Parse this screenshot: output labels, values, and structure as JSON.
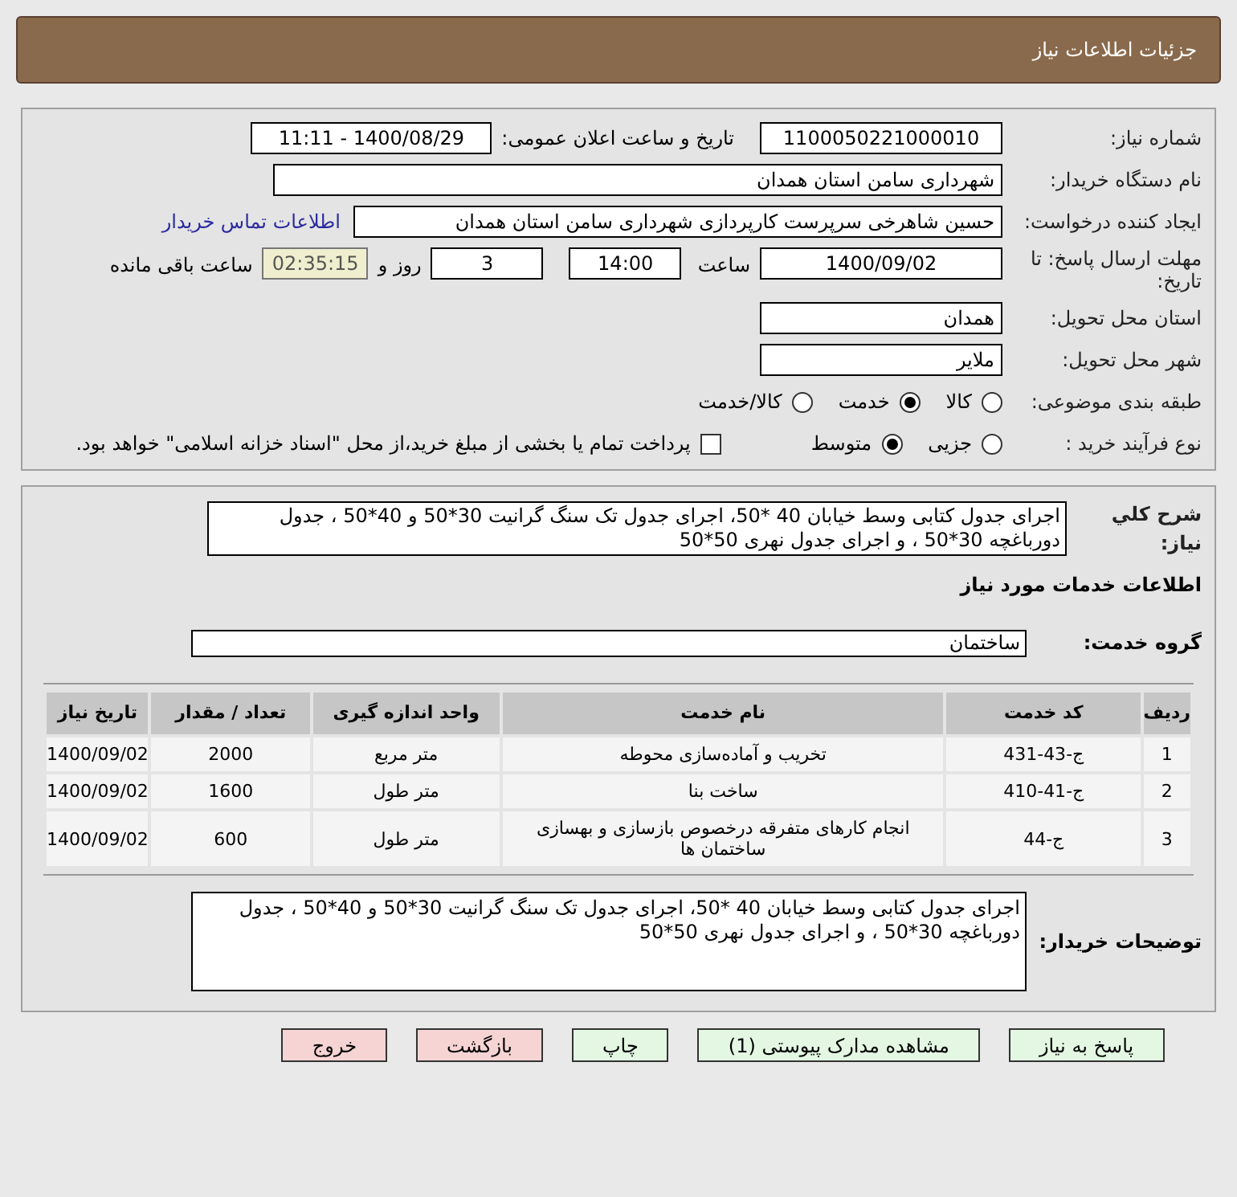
{
  "header": {
    "title": "جزئیات اطلاعات نیاز"
  },
  "need_number": {
    "label": "شماره نیاز:",
    "value": "1100050221000010"
  },
  "announce": {
    "label": "تاریخ و ساعت اعلان عمومی:",
    "value": "1400/08/29 - 11:11"
  },
  "buyer_org": {
    "label": "نام دستگاه خریدار:",
    "value": "شهرداری سامن استان همدان"
  },
  "requester": {
    "label": "ایجاد کننده درخواست:",
    "value": "حسین شاهرخی سرپرست کارپردازی شهرداری سامن استان همدان",
    "link": "اطلاعات تماس خریدار"
  },
  "deadline": {
    "label": "مهلت ارسال پاسخ: تا تاریخ:",
    "date": "1400/09/02",
    "time_label": "ساعت",
    "time": "14:00",
    "days": "3",
    "days_label": "روز و",
    "remaining": "02:35:15",
    "remaining_label": "ساعت باقی مانده"
  },
  "province": {
    "label": "استان محل تحویل:",
    "value": "همدان"
  },
  "city": {
    "label": "شهر محل تحویل:",
    "value": "ملایر"
  },
  "category": {
    "label": "طبقه بندی موضوعی:",
    "options": [
      {
        "label": "کالا",
        "selected": false
      },
      {
        "label": "خدمت",
        "selected": true
      },
      {
        "label": "کالا/خدمت",
        "selected": false
      }
    ]
  },
  "purchase_type": {
    "label": "نوع فرآیند خرید :",
    "options": [
      {
        "label": "جزیی",
        "selected": false
      },
      {
        "label": "متوسط",
        "selected": true
      }
    ],
    "payment_checkbox": {
      "checked": false,
      "label": "پرداخت تمام یا بخشی از مبلغ خرید،از محل \"اسناد خزانه اسلامی\" خواهد بود."
    }
  },
  "description": {
    "label": "شرح کلي نیاز:",
    "value": "اجرای جدول کتابی وسط خیابان  40 *50، اجرای جدول تک سنگ گرانیت 30*50  و 40*50 ، جدول دورباغچه 30*50  ، و اجرای جدول نهری 50*50"
  },
  "services_heading": "اطلاعات خدمات مورد نیاز",
  "service_group": {
    "label": "گروه خدمت:",
    "value": "ساختمان"
  },
  "table": {
    "columns": [
      "ردیف",
      "کد خدمت",
      "نام خدمت",
      "واحد اندازه گیری",
      "تعداد / مقدار",
      "تاریخ نیاز"
    ],
    "rows": [
      [
        "1",
        "ج-43-431",
        "تخریب و آماده‌سازی محوطه",
        "متر مربع",
        "2000",
        "1400/09/02"
      ],
      [
        "2",
        "ج-41-410",
        "ساخت بنا",
        "متر طول",
        "1600",
        "1400/09/02"
      ],
      [
        "3",
        "ج-44",
        "انجام کارهای متفرقه درخصوص بازسازی و بهسازی ساختمان ها",
        "متر طول",
        "600",
        "1400/09/02"
      ]
    ]
  },
  "buyer_notes": {
    "label": "توضیحات خریدار:",
    "value": "اجرای جدول کتابی وسط خیابان  40 *50، اجرای جدول تک سنگ گرانیت 30*50  و 40*50 ، جدول دورباغچه 30*50  ، و اجرای جدول نهری 50*50"
  },
  "buttons": [
    {
      "label": "پاسخ به نیاز",
      "kind": "primary"
    },
    {
      "label": "مشاهده مدارک پیوستی (1)",
      "kind": "primary"
    },
    {
      "label": "چاپ",
      "kind": "primary"
    },
    {
      "label": "بازگشت",
      "kind": "danger"
    },
    {
      "label": "خروج",
      "kind": "danger"
    }
  ]
}
